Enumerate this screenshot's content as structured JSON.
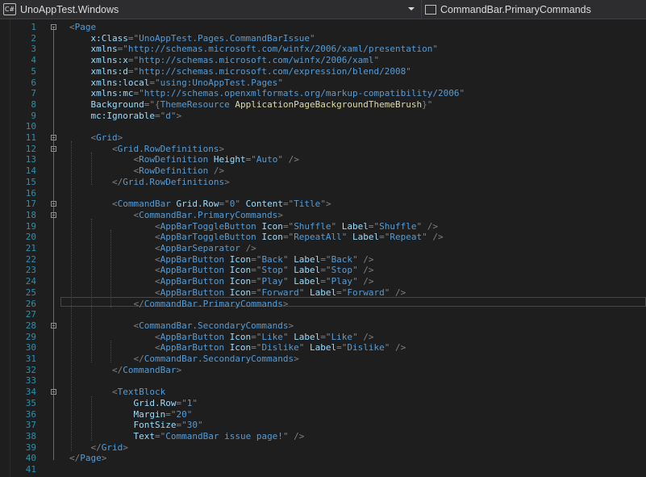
{
  "nav": {
    "project_label": "UnoAppTest.Windows",
    "project_icon": "C#",
    "member_label": "CommandBar.PrimaryCommands"
  },
  "editor": {
    "lines": [
      {
        "n": "1",
        "parts": [
          {
            "c": "d",
            "t": "<"
          },
          {
            "c": "t",
            "t": "Page"
          }
        ]
      },
      {
        "n": "2",
        "parts": [
          {
            "c": "x",
            "t": "    "
          },
          {
            "c": "a",
            "t": "x:Class"
          },
          {
            "c": "d",
            "t": "=\""
          },
          {
            "c": "v",
            "t": "UnoAppTest.Pages.CommandBarIssue"
          },
          {
            "c": "d",
            "t": "\""
          }
        ]
      },
      {
        "n": "3",
        "parts": [
          {
            "c": "x",
            "t": "    "
          },
          {
            "c": "a",
            "t": "xmlns"
          },
          {
            "c": "d",
            "t": "=\""
          },
          {
            "c": "v",
            "t": "http://schemas.microsoft.com/winfx/2006/xaml/presentation"
          },
          {
            "c": "d",
            "t": "\""
          }
        ]
      },
      {
        "n": "4",
        "parts": [
          {
            "c": "x",
            "t": "    "
          },
          {
            "c": "a",
            "t": "xmlns:x"
          },
          {
            "c": "d",
            "t": "=\""
          },
          {
            "c": "v",
            "t": "http://schemas.microsoft.com/winfx/2006/xaml"
          },
          {
            "c": "d",
            "t": "\""
          }
        ]
      },
      {
        "n": "5",
        "parts": [
          {
            "c": "x",
            "t": "    "
          },
          {
            "c": "a",
            "t": "xmlns:d"
          },
          {
            "c": "d",
            "t": "=\""
          },
          {
            "c": "v",
            "t": "http://schemas.microsoft.com/expression/blend/2008"
          },
          {
            "c": "d",
            "t": "\""
          }
        ]
      },
      {
        "n": "6",
        "parts": [
          {
            "c": "x",
            "t": "    "
          },
          {
            "c": "a",
            "t": "xmlns:local"
          },
          {
            "c": "d",
            "t": "=\""
          },
          {
            "c": "v",
            "t": "using:UnoAppTest.Pages"
          },
          {
            "c": "d",
            "t": "\""
          }
        ]
      },
      {
        "n": "7",
        "parts": [
          {
            "c": "x",
            "t": "    "
          },
          {
            "c": "a",
            "t": "xmlns:mc"
          },
          {
            "c": "d",
            "t": "=\""
          },
          {
            "c": "v",
            "t": "http://schemas.openxmlformats.org/markup-compatibility/2006"
          },
          {
            "c": "d",
            "t": "\""
          }
        ]
      },
      {
        "n": "8",
        "parts": [
          {
            "c": "x",
            "t": "    "
          },
          {
            "c": "a",
            "t": "Background"
          },
          {
            "c": "d",
            "t": "=\""
          },
          {
            "c": "d",
            "t": "{"
          },
          {
            "c": "t",
            "t": "ThemeResource "
          },
          {
            "c": "res",
            "t": "ApplicationPageBackgroundThemeBrush"
          },
          {
            "c": "d",
            "t": "}"
          },
          {
            "c": "d",
            "t": "\""
          }
        ]
      },
      {
        "n": "9",
        "parts": [
          {
            "c": "x",
            "t": "    "
          },
          {
            "c": "a",
            "t": "mc:Ignorable"
          },
          {
            "c": "d",
            "t": "=\""
          },
          {
            "c": "v",
            "t": "d"
          },
          {
            "c": "d",
            "t": "\""
          },
          {
            "c": "d",
            "t": ">"
          }
        ]
      },
      {
        "n": "10",
        "parts": []
      },
      {
        "n": "11",
        "parts": [
          {
            "c": "x",
            "t": "    "
          },
          {
            "c": "d",
            "t": "<"
          },
          {
            "c": "t",
            "t": "Grid"
          },
          {
            "c": "d",
            "t": ">"
          }
        ]
      },
      {
        "n": "12",
        "parts": [
          {
            "c": "x",
            "t": "        "
          },
          {
            "c": "d",
            "t": "<"
          },
          {
            "c": "t",
            "t": "Grid.RowDefinitions"
          },
          {
            "c": "d",
            "t": ">"
          }
        ]
      },
      {
        "n": "13",
        "parts": [
          {
            "c": "x",
            "t": "            "
          },
          {
            "c": "d",
            "t": "<"
          },
          {
            "c": "t",
            "t": "RowDefinition "
          },
          {
            "c": "a",
            "t": "Height"
          },
          {
            "c": "d",
            "t": "=\""
          },
          {
            "c": "v",
            "t": "Auto"
          },
          {
            "c": "d",
            "t": "\""
          },
          {
            "c": "d",
            "t": " />"
          }
        ]
      },
      {
        "n": "14",
        "parts": [
          {
            "c": "x",
            "t": "            "
          },
          {
            "c": "d",
            "t": "<"
          },
          {
            "c": "t",
            "t": "RowDefinition "
          },
          {
            "c": "d",
            "t": "/>"
          }
        ]
      },
      {
        "n": "15",
        "parts": [
          {
            "c": "x",
            "t": "        "
          },
          {
            "c": "d",
            "t": "</"
          },
          {
            "c": "t",
            "t": "Grid.RowDefinitions"
          },
          {
            "c": "d",
            "t": ">"
          }
        ]
      },
      {
        "n": "16",
        "parts": []
      },
      {
        "n": "17",
        "parts": [
          {
            "c": "x",
            "t": "        "
          },
          {
            "c": "d",
            "t": "<"
          },
          {
            "c": "t",
            "t": "CommandBar "
          },
          {
            "c": "a",
            "t": "Grid.Row"
          },
          {
            "c": "d",
            "t": "=\""
          },
          {
            "c": "v",
            "t": "0"
          },
          {
            "c": "d",
            "t": "\" "
          },
          {
            "c": "a",
            "t": "Content"
          },
          {
            "c": "d",
            "t": "=\""
          },
          {
            "c": "v",
            "t": "Title"
          },
          {
            "c": "d",
            "t": "\""
          },
          {
            "c": "d",
            "t": ">"
          }
        ]
      },
      {
        "n": "18",
        "parts": [
          {
            "c": "x",
            "t": "            "
          },
          {
            "c": "d",
            "t": "<"
          },
          {
            "c": "t",
            "t": "CommandBar.PrimaryCommands"
          },
          {
            "c": "d",
            "t": ">"
          }
        ]
      },
      {
        "n": "19",
        "parts": [
          {
            "c": "x",
            "t": "                "
          },
          {
            "c": "d",
            "t": "<"
          },
          {
            "c": "t",
            "t": "AppBarToggleButton "
          },
          {
            "c": "a",
            "t": "Icon"
          },
          {
            "c": "d",
            "t": "=\""
          },
          {
            "c": "v",
            "t": "Shuffle"
          },
          {
            "c": "d",
            "t": "\" "
          },
          {
            "c": "a",
            "t": "Label"
          },
          {
            "c": "d",
            "t": "=\""
          },
          {
            "c": "v",
            "t": "Shuffle"
          },
          {
            "c": "d",
            "t": "\""
          },
          {
            "c": "d",
            "t": " />"
          }
        ]
      },
      {
        "n": "20",
        "parts": [
          {
            "c": "x",
            "t": "                "
          },
          {
            "c": "d",
            "t": "<"
          },
          {
            "c": "t",
            "t": "AppBarToggleButton "
          },
          {
            "c": "a",
            "t": "Icon"
          },
          {
            "c": "d",
            "t": "=\""
          },
          {
            "c": "v",
            "t": "RepeatAll"
          },
          {
            "c": "d",
            "t": "\" "
          },
          {
            "c": "a",
            "t": "Label"
          },
          {
            "c": "d",
            "t": "=\""
          },
          {
            "c": "v",
            "t": "Repeat"
          },
          {
            "c": "d",
            "t": "\""
          },
          {
            "c": "d",
            "t": " />"
          }
        ]
      },
      {
        "n": "21",
        "parts": [
          {
            "c": "x",
            "t": "                "
          },
          {
            "c": "d",
            "t": "<"
          },
          {
            "c": "t",
            "t": "AppBarSeparator "
          },
          {
            "c": "d",
            "t": "/>"
          }
        ]
      },
      {
        "n": "22",
        "parts": [
          {
            "c": "x",
            "t": "                "
          },
          {
            "c": "d",
            "t": "<"
          },
          {
            "c": "t",
            "t": "AppBarButton "
          },
          {
            "c": "a",
            "t": "Icon"
          },
          {
            "c": "d",
            "t": "=\""
          },
          {
            "c": "v",
            "t": "Back"
          },
          {
            "c": "d",
            "t": "\" "
          },
          {
            "c": "a",
            "t": "Label"
          },
          {
            "c": "d",
            "t": "=\""
          },
          {
            "c": "v",
            "t": "Back"
          },
          {
            "c": "d",
            "t": "\""
          },
          {
            "c": "d",
            "t": " />"
          }
        ]
      },
      {
        "n": "23",
        "parts": [
          {
            "c": "x",
            "t": "                "
          },
          {
            "c": "d",
            "t": "<"
          },
          {
            "c": "t",
            "t": "AppBarButton "
          },
          {
            "c": "a",
            "t": "Icon"
          },
          {
            "c": "d",
            "t": "=\""
          },
          {
            "c": "v",
            "t": "Stop"
          },
          {
            "c": "d",
            "t": "\" "
          },
          {
            "c": "a",
            "t": "Label"
          },
          {
            "c": "d",
            "t": "=\""
          },
          {
            "c": "v",
            "t": "Stop"
          },
          {
            "c": "d",
            "t": "\""
          },
          {
            "c": "d",
            "t": " />"
          }
        ]
      },
      {
        "n": "24",
        "parts": [
          {
            "c": "x",
            "t": "                "
          },
          {
            "c": "d",
            "t": "<"
          },
          {
            "c": "t",
            "t": "AppBarButton "
          },
          {
            "c": "a",
            "t": "Icon"
          },
          {
            "c": "d",
            "t": "=\""
          },
          {
            "c": "v",
            "t": "Play"
          },
          {
            "c": "d",
            "t": "\" "
          },
          {
            "c": "a",
            "t": "Label"
          },
          {
            "c": "d",
            "t": "=\""
          },
          {
            "c": "v",
            "t": "Play"
          },
          {
            "c": "d",
            "t": "\""
          },
          {
            "c": "d",
            "t": " />"
          }
        ]
      },
      {
        "n": "25",
        "parts": [
          {
            "c": "x",
            "t": "                "
          },
          {
            "c": "d",
            "t": "<"
          },
          {
            "c": "t",
            "t": "AppBarButton "
          },
          {
            "c": "a",
            "t": "Icon"
          },
          {
            "c": "d",
            "t": "=\""
          },
          {
            "c": "v",
            "t": "Forward"
          },
          {
            "c": "d",
            "t": "\" "
          },
          {
            "c": "a",
            "t": "Label"
          },
          {
            "c": "d",
            "t": "=\""
          },
          {
            "c": "v",
            "t": "Forward"
          },
          {
            "c": "d",
            "t": "\""
          },
          {
            "c": "d",
            "t": " />"
          }
        ]
      },
      {
        "n": "26",
        "parts": [
          {
            "c": "x",
            "t": "            "
          },
          {
            "c": "d",
            "t": "</"
          },
          {
            "c": "t",
            "t": "CommandBar.PrimaryCommands"
          },
          {
            "c": "d",
            "t": ">"
          }
        ]
      },
      {
        "n": "27",
        "parts": []
      },
      {
        "n": "28",
        "parts": [
          {
            "c": "x",
            "t": "            "
          },
          {
            "c": "d",
            "t": "<"
          },
          {
            "c": "t",
            "t": "CommandBar.SecondaryCommands"
          },
          {
            "c": "d",
            "t": ">"
          }
        ]
      },
      {
        "n": "29",
        "parts": [
          {
            "c": "x",
            "t": "                "
          },
          {
            "c": "d",
            "t": "<"
          },
          {
            "c": "t",
            "t": "AppBarButton "
          },
          {
            "c": "a",
            "t": "Icon"
          },
          {
            "c": "d",
            "t": "=\""
          },
          {
            "c": "v",
            "t": "Like"
          },
          {
            "c": "d",
            "t": "\" "
          },
          {
            "c": "a",
            "t": "Label"
          },
          {
            "c": "d",
            "t": "=\""
          },
          {
            "c": "v",
            "t": "Like"
          },
          {
            "c": "d",
            "t": "\""
          },
          {
            "c": "d",
            "t": " />"
          }
        ]
      },
      {
        "n": "30",
        "parts": [
          {
            "c": "x",
            "t": "                "
          },
          {
            "c": "d",
            "t": "<"
          },
          {
            "c": "t",
            "t": "AppBarButton "
          },
          {
            "c": "a",
            "t": "Icon"
          },
          {
            "c": "d",
            "t": "=\""
          },
          {
            "c": "v",
            "t": "Dislike"
          },
          {
            "c": "d",
            "t": "\" "
          },
          {
            "c": "a",
            "t": "Label"
          },
          {
            "c": "d",
            "t": "=\""
          },
          {
            "c": "v",
            "t": "Dislike"
          },
          {
            "c": "d",
            "t": "\""
          },
          {
            "c": "d",
            "t": " />"
          }
        ]
      },
      {
        "n": "31",
        "parts": [
          {
            "c": "x",
            "t": "            "
          },
          {
            "c": "d",
            "t": "</"
          },
          {
            "c": "t",
            "t": "CommandBar.SecondaryCommands"
          },
          {
            "c": "d",
            "t": ">"
          }
        ]
      },
      {
        "n": "32",
        "parts": [
          {
            "c": "x",
            "t": "        "
          },
          {
            "c": "d",
            "t": "</"
          },
          {
            "c": "t",
            "t": "CommandBar"
          },
          {
            "c": "d",
            "t": ">"
          }
        ]
      },
      {
        "n": "33",
        "parts": []
      },
      {
        "n": "34",
        "parts": [
          {
            "c": "x",
            "t": "        "
          },
          {
            "c": "d",
            "t": "<"
          },
          {
            "c": "t",
            "t": "TextBlock"
          }
        ]
      },
      {
        "n": "35",
        "parts": [
          {
            "c": "x",
            "t": "            "
          },
          {
            "c": "a",
            "t": "Grid.Row"
          },
          {
            "c": "d",
            "t": "=\""
          },
          {
            "c": "v",
            "t": "1"
          },
          {
            "c": "d",
            "t": "\""
          }
        ]
      },
      {
        "n": "36",
        "parts": [
          {
            "c": "x",
            "t": "            "
          },
          {
            "c": "a",
            "t": "Margin"
          },
          {
            "c": "d",
            "t": "=\""
          },
          {
            "c": "v",
            "t": "20"
          },
          {
            "c": "d",
            "t": "\""
          }
        ]
      },
      {
        "n": "37",
        "parts": [
          {
            "c": "x",
            "t": "            "
          },
          {
            "c": "a",
            "t": "FontSize"
          },
          {
            "c": "d",
            "t": "=\""
          },
          {
            "c": "v",
            "t": "30"
          },
          {
            "c": "d",
            "t": "\""
          }
        ]
      },
      {
        "n": "38",
        "parts": [
          {
            "c": "x",
            "t": "            "
          },
          {
            "c": "a",
            "t": "Text"
          },
          {
            "c": "d",
            "t": "=\""
          },
          {
            "c": "v",
            "t": "CommandBar issue page!"
          },
          {
            "c": "d",
            "t": "\""
          },
          {
            "c": "d",
            "t": " />"
          }
        ]
      },
      {
        "n": "39",
        "parts": [
          {
            "c": "x",
            "t": "    "
          },
          {
            "c": "d",
            "t": "</"
          },
          {
            "c": "t",
            "t": "Grid"
          },
          {
            "c": "d",
            "t": ">"
          }
        ]
      },
      {
        "n": "40",
        "parts": [
          {
            "c": "d",
            "t": "</"
          },
          {
            "c": "t",
            "t": "Page"
          },
          {
            "c": "d",
            "t": ">"
          }
        ]
      },
      {
        "n": "41",
        "parts": []
      }
    ]
  }
}
